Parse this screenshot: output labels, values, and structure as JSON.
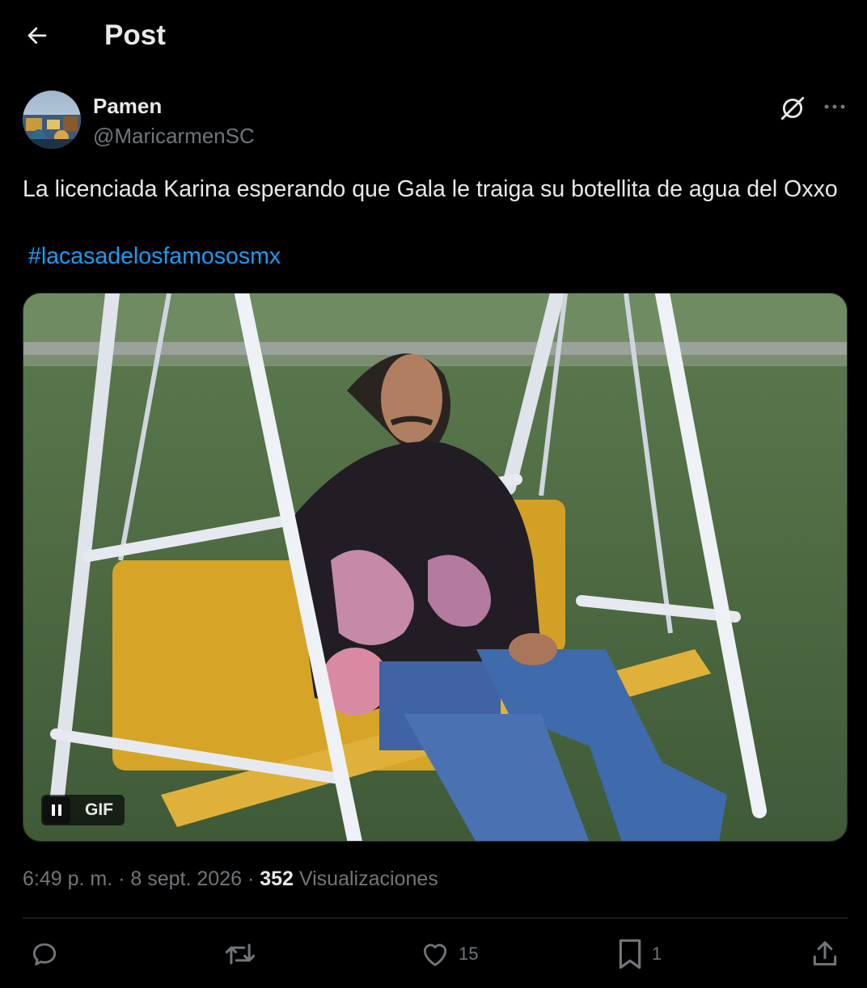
{
  "header": {
    "title": "Post",
    "back_icon": "arrow-left-icon"
  },
  "author": {
    "display_name": "Pamen",
    "handle": "@MaricarmenSC"
  },
  "tweet": {
    "text": "La licenciada Karina esperando que Gala le traiga su botellita de agua del Oxxo",
    "hashtag": "#lacasadelosfamososmx"
  },
  "media": {
    "type_label": "GIF",
    "pause_icon": "pause-icon"
  },
  "meta": {
    "time": "6:49 p. m.",
    "separator": " · ",
    "date": "8 sept. 2026",
    "views_count": "352",
    "views_label": "Visualizaciones"
  },
  "actions": {
    "reply_count": "",
    "repost_count": "",
    "like_count": "15",
    "bookmark_count": "1"
  },
  "colors": {
    "background": "#000000",
    "text": "#e7e9ea",
    "muted": "#71767b",
    "link": "#1d9bf0",
    "border": "#2f3336"
  }
}
